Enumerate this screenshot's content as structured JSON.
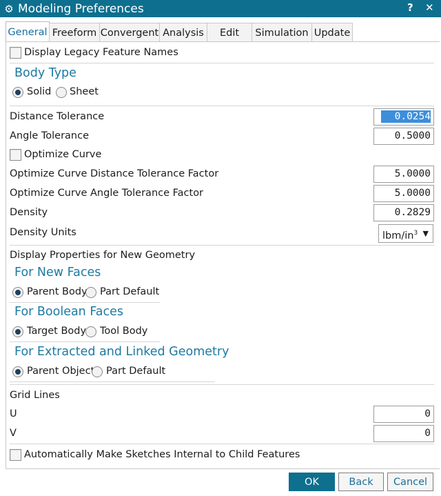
{
  "window": {
    "title": "Modeling Preferences",
    "help": "?",
    "close": "✕"
  },
  "tabs": [
    "General",
    "Freeform",
    "Convergent",
    "Analysis",
    "Edit",
    "Simulation",
    "Update"
  ],
  "legacy": {
    "label": "Display Legacy Feature Names",
    "checked": false
  },
  "body_type": {
    "title": "Body Type",
    "solid": "Solid",
    "sheet": "Sheet",
    "selected": "Solid"
  },
  "fields": {
    "distance_tolerance": {
      "label": "Distance Tolerance",
      "value": "0.0254"
    },
    "angle_tolerance": {
      "label": "Angle Tolerance",
      "value": "0.5000"
    },
    "optimize_curve": {
      "label": "Optimize Curve",
      "checked": false
    },
    "oc_distance_factor": {
      "label": "Optimize Curve Distance Tolerance Factor",
      "value": "5.0000"
    },
    "oc_angle_factor": {
      "label": "Optimize Curve Angle Tolerance Factor",
      "value": "5.0000"
    },
    "density": {
      "label": "Density",
      "value": "0.2829"
    },
    "density_units": {
      "label": "Density Units",
      "value": "lbm/in",
      "sup": "3"
    }
  },
  "display_props": {
    "label": "Display Properties for New Geometry",
    "new_faces": {
      "title": "For New Faces",
      "opt1": "Parent Body",
      "opt2": "Part Default",
      "selected": "Parent Body"
    },
    "boolean_faces": {
      "title": "For Boolean Faces",
      "opt1": "Target Body",
      "opt2": "Tool Body",
      "selected": "Target Body"
    },
    "extracted": {
      "title": "For Extracted and Linked Geometry",
      "opt1": "Parent Object",
      "opt2": "Part Default",
      "selected": "Parent Object"
    }
  },
  "grid": {
    "label": "Grid Lines",
    "u_label": "U",
    "u_value": "0",
    "v_label": "V",
    "v_value": "0"
  },
  "sketches": {
    "label": "Automatically Make Sketches Internal to Child Features",
    "checked": false
  },
  "buttons": {
    "ok": "OK",
    "back": "Back",
    "cancel": "Cancel"
  },
  "colors": {
    "titlebar": "#0e6f8e",
    "accent": "#1d7aa3",
    "selection": "#3d8edb"
  }
}
